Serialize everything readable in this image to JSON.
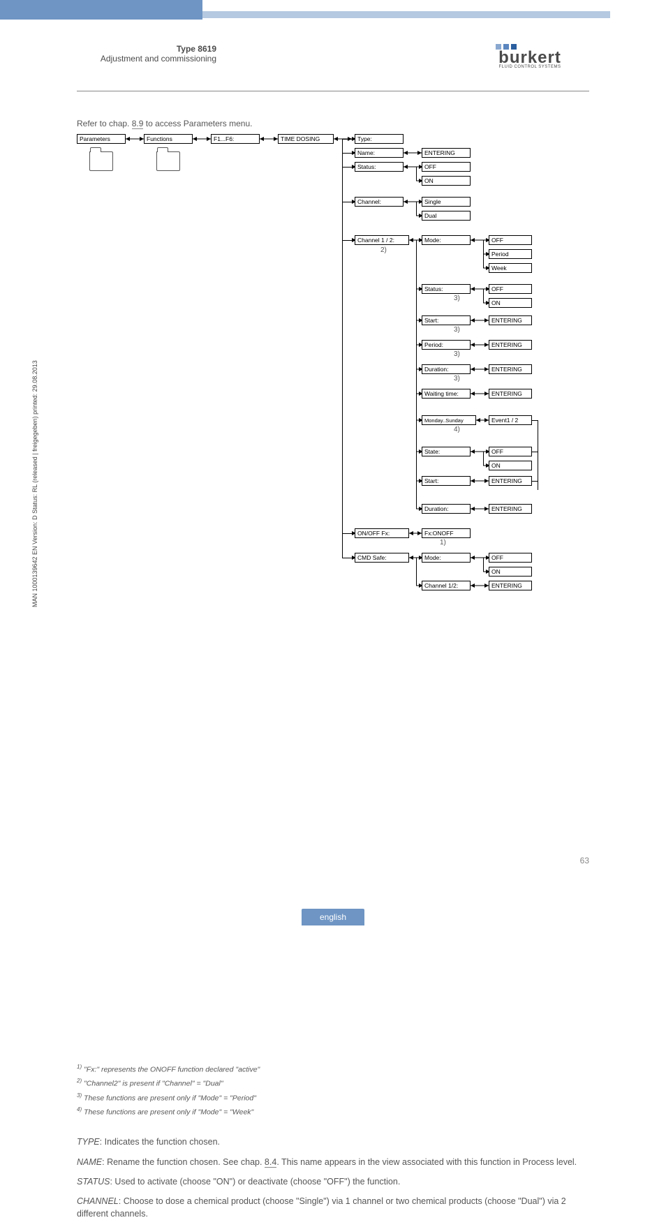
{
  "header": {
    "title_bold": "Type 8619",
    "title_sub": "Adjustment and commissioning",
    "logo_text": "burkert",
    "logo_sub": "FLUID CONTROL SYSTEMS"
  },
  "intro": {
    "prefix": "Refer to chap. ",
    "ref": "8.9",
    "suffix": " to access Parameters menu."
  },
  "diagram": {
    "a": {
      "parameters": "Parameters",
      "functions": "Functions",
      "f1f6": "F1...F6:",
      "timedosing": "TIME DOSING"
    },
    "b": {
      "type": "Type:",
      "name": "Name:",
      "entering": "ENTERING",
      "status": "Status:",
      "off": "OFF",
      "on": "ON",
      "channel": "Channel:",
      "single": "Single",
      "dual": "Dual",
      "ch12": "Channel 1 / 2:",
      "note2": "2)",
      "mode": "Mode:",
      "period": "Period",
      "week": "Week",
      "status2": "Status:",
      "note3a": "3)",
      "start": "Start:",
      "note3b": "3)",
      "period2": "Period:",
      "note3c": "3)",
      "duration": "Duration:",
      "note3d": "3)",
      "waiting": "Waiting time:",
      "monsun": "Monday..Sunday",
      "note4": "4)",
      "event": "Event1 / 2",
      "state": "State:",
      "start2": "Start:",
      "duration2": "Duration:",
      "onofffx": "ON/OFF Fx:",
      "note1": "1)",
      "fxonoff": "Fx:ONOFF",
      "cmdsafe": "CMD Safe:",
      "mode2": "Mode:",
      "ch12b": "Channel 1/2:"
    }
  },
  "footnotes": {
    "f1": "\"Fx:\" represents the ONOFF function declared \"active\"",
    "f2": "\"Channel2\" is present if \"Channel\" = \"Dual\"",
    "f3": "These functions are present only if \"Mode\" = \"Period\"",
    "f4": "These functions are present only if \"Mode\" = \"Week\""
  },
  "desc": {
    "type": {
      "label": "TYPE",
      "text": ": Indicates the function chosen."
    },
    "name": {
      "label": "NAME",
      "text1": ": Rename the function chosen. See chap. ",
      "ref": "8.4",
      "text2": ". This name appears in the view associated with this function in Process level."
    },
    "status": {
      "label": "STATUS",
      "text": ": Used to activate (choose \"ON\") or deactivate (choose \"OFF\") the function."
    },
    "channel": {
      "label": "CHANNEL",
      "text": ": Choose to dose a chemical product (choose \"Single\") via 1 channel or two chemical products (choose \"Dual\") via 2 different channels."
    }
  },
  "sidetext": "MAN 1000139642 EN Version: D Status: RL (released | freigegeben) printed: 29.08.2013",
  "pagenum": "63",
  "footer": {
    "lang": "english"
  }
}
